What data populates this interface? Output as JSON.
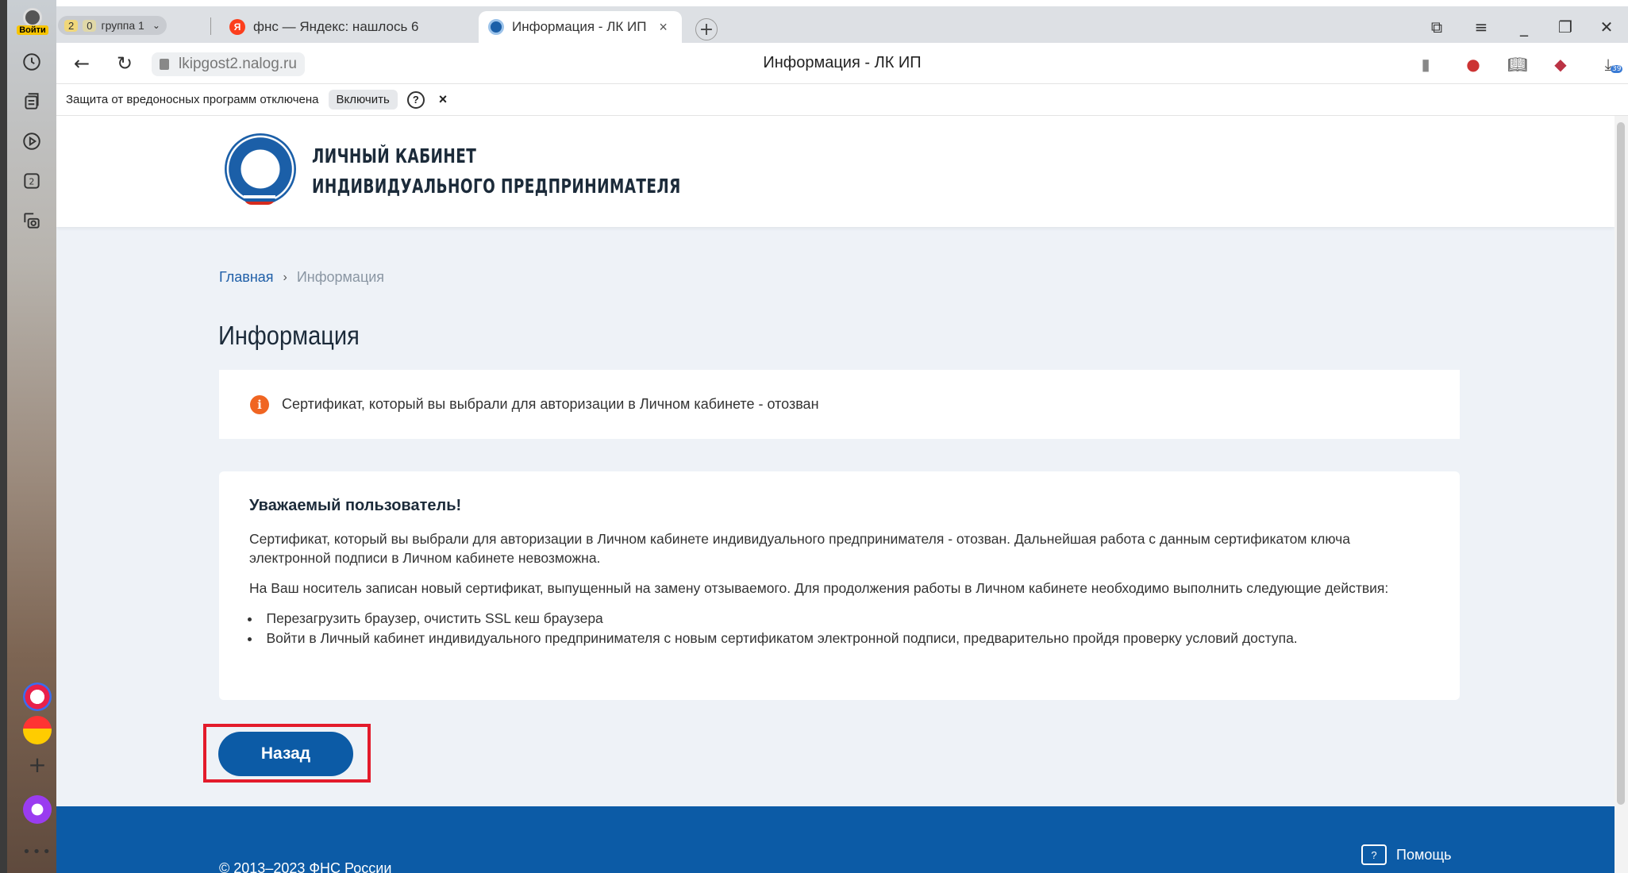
{
  "browser": {
    "login_label": "Войти",
    "tab_group_count": "2",
    "tab_group_zero": "0",
    "tab_group_name": "группа 1",
    "tabs": [
      {
        "label": "фнс — Яндекс: нашлось 6",
        "favicon": "yandex-icon"
      },
      {
        "label": "Информация - ЛК ИП",
        "favicon": "fns-icon"
      }
    ],
    "url": "lkipgost2.nalog.ru",
    "page_title": "Информация - ЛК ИП",
    "download_badge": "39"
  },
  "protection_bar": {
    "message": "Защита от вредоносных программ отключена",
    "enable_label": "Включить",
    "help_label": "?",
    "close_label": "×"
  },
  "header": {
    "brand_line1": "ЛИЧНЫЙ КАБИНЕТ",
    "brand_line2": "ИНДИВИДУАЛЬНОГО ПРЕДПРИНИМАТЕЛЯ"
  },
  "breadcrumb": {
    "home": "Главная",
    "separator": "›",
    "current": "Информация"
  },
  "main": {
    "title": "Информация",
    "alert_icon": "i",
    "alert_text": "Сертификат, который вы выбрали для авторизации в Личном кабинете - отозван",
    "card": {
      "heading": "Уважаемый пользователь!",
      "paragraph1": "Сертификат, который вы выбрали для авторизации в Личном кабинете индивидуального предпринимателя - отозван. Дальнейшая работа с данным сертификатом ключа электронной подписи в Личном кабинете невозможна.",
      "paragraph2": "На Ваш носитель записан новый сертификат, выпущенный на замену отзываемого. Для продолжения работы в Личном кабинете необходимо выполнить следующие действия:",
      "steps": [
        "Перезагрузить браузер, очистить SSL кеш браузера",
        "Войти в Личный кабинет индивидуального предпринимателя с новым сертификатом электронной подписи, предварительно пройдя проверку условий доступа."
      ]
    },
    "back_button": "Назад"
  },
  "footer": {
    "copyright": "© 2013–2023 ФНС России",
    "help": "Помощь",
    "help_icon_glyph": "?"
  },
  "colors": {
    "accent": "#0c5ba6",
    "alert_icon": "#f06522",
    "highlight_box": "#e31b2b",
    "page_bg": "#eef2f7"
  }
}
